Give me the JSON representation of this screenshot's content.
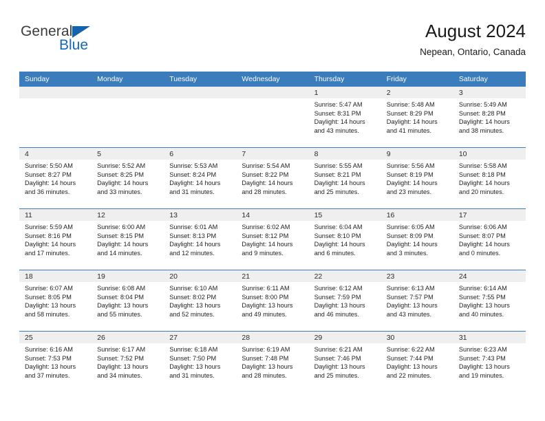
{
  "brand": {
    "name_top": "General",
    "name_bottom": "Blue",
    "triangle_color": "#1263b0",
    "text_color": "#3b3b3b",
    "accent_color": "#1268bb"
  },
  "header": {
    "title": "August 2024",
    "subtitle": "Nepean, Ontario, Canada"
  },
  "theme": {
    "header_row_bg": "#3b7cbd",
    "header_row_text": "#ffffff",
    "daynum_band_bg": "#efefef",
    "row_divider": "#3b7cbd"
  },
  "weekdays": [
    "Sunday",
    "Monday",
    "Tuesday",
    "Wednesday",
    "Thursday",
    "Friday",
    "Saturday"
  ],
  "weeks": [
    [
      {
        "day": "",
        "empty": true,
        "sunrise": "",
        "sunset": "",
        "daylight_1": "",
        "daylight_2": ""
      },
      {
        "day": "",
        "empty": true,
        "sunrise": "",
        "sunset": "",
        "daylight_1": "",
        "daylight_2": ""
      },
      {
        "day": "",
        "empty": true,
        "sunrise": "",
        "sunset": "",
        "daylight_1": "",
        "daylight_2": ""
      },
      {
        "day": "",
        "empty": true,
        "sunrise": "",
        "sunset": "",
        "daylight_1": "",
        "daylight_2": ""
      },
      {
        "day": "1",
        "sunrise": "Sunrise: 5:47 AM",
        "sunset": "Sunset: 8:31 PM",
        "daylight_1": "Daylight: 14 hours",
        "daylight_2": "and 43 minutes."
      },
      {
        "day": "2",
        "sunrise": "Sunrise: 5:48 AM",
        "sunset": "Sunset: 8:29 PM",
        "daylight_1": "Daylight: 14 hours",
        "daylight_2": "and 41 minutes."
      },
      {
        "day": "3",
        "sunrise": "Sunrise: 5:49 AM",
        "sunset": "Sunset: 8:28 PM",
        "daylight_1": "Daylight: 14 hours",
        "daylight_2": "and 38 minutes."
      }
    ],
    [
      {
        "day": "4",
        "sunrise": "Sunrise: 5:50 AM",
        "sunset": "Sunset: 8:27 PM",
        "daylight_1": "Daylight: 14 hours",
        "daylight_2": "and 36 minutes."
      },
      {
        "day": "5",
        "sunrise": "Sunrise: 5:52 AM",
        "sunset": "Sunset: 8:25 PM",
        "daylight_1": "Daylight: 14 hours",
        "daylight_2": "and 33 minutes."
      },
      {
        "day": "6",
        "sunrise": "Sunrise: 5:53 AM",
        "sunset": "Sunset: 8:24 PM",
        "daylight_1": "Daylight: 14 hours",
        "daylight_2": "and 31 minutes."
      },
      {
        "day": "7",
        "sunrise": "Sunrise: 5:54 AM",
        "sunset": "Sunset: 8:22 PM",
        "daylight_1": "Daylight: 14 hours",
        "daylight_2": "and 28 minutes."
      },
      {
        "day": "8",
        "sunrise": "Sunrise: 5:55 AM",
        "sunset": "Sunset: 8:21 PM",
        "daylight_1": "Daylight: 14 hours",
        "daylight_2": "and 25 minutes."
      },
      {
        "day": "9",
        "sunrise": "Sunrise: 5:56 AM",
        "sunset": "Sunset: 8:19 PM",
        "daylight_1": "Daylight: 14 hours",
        "daylight_2": "and 23 minutes."
      },
      {
        "day": "10",
        "sunrise": "Sunrise: 5:58 AM",
        "sunset": "Sunset: 8:18 PM",
        "daylight_1": "Daylight: 14 hours",
        "daylight_2": "and 20 minutes."
      }
    ],
    [
      {
        "day": "11",
        "sunrise": "Sunrise: 5:59 AM",
        "sunset": "Sunset: 8:16 PM",
        "daylight_1": "Daylight: 14 hours",
        "daylight_2": "and 17 minutes."
      },
      {
        "day": "12",
        "sunrise": "Sunrise: 6:00 AM",
        "sunset": "Sunset: 8:15 PM",
        "daylight_1": "Daylight: 14 hours",
        "daylight_2": "and 14 minutes."
      },
      {
        "day": "13",
        "sunrise": "Sunrise: 6:01 AM",
        "sunset": "Sunset: 8:13 PM",
        "daylight_1": "Daylight: 14 hours",
        "daylight_2": "and 12 minutes."
      },
      {
        "day": "14",
        "sunrise": "Sunrise: 6:02 AM",
        "sunset": "Sunset: 8:12 PM",
        "daylight_1": "Daylight: 14 hours",
        "daylight_2": "and 9 minutes."
      },
      {
        "day": "15",
        "sunrise": "Sunrise: 6:04 AM",
        "sunset": "Sunset: 8:10 PM",
        "daylight_1": "Daylight: 14 hours",
        "daylight_2": "and 6 minutes."
      },
      {
        "day": "16",
        "sunrise": "Sunrise: 6:05 AM",
        "sunset": "Sunset: 8:09 PM",
        "daylight_1": "Daylight: 14 hours",
        "daylight_2": "and 3 minutes."
      },
      {
        "day": "17",
        "sunrise": "Sunrise: 6:06 AM",
        "sunset": "Sunset: 8:07 PM",
        "daylight_1": "Daylight: 14 hours",
        "daylight_2": "and 0 minutes."
      }
    ],
    [
      {
        "day": "18",
        "sunrise": "Sunrise: 6:07 AM",
        "sunset": "Sunset: 8:05 PM",
        "daylight_1": "Daylight: 13 hours",
        "daylight_2": "and 58 minutes."
      },
      {
        "day": "19",
        "sunrise": "Sunrise: 6:08 AM",
        "sunset": "Sunset: 8:04 PM",
        "daylight_1": "Daylight: 13 hours",
        "daylight_2": "and 55 minutes."
      },
      {
        "day": "20",
        "sunrise": "Sunrise: 6:10 AM",
        "sunset": "Sunset: 8:02 PM",
        "daylight_1": "Daylight: 13 hours",
        "daylight_2": "and 52 minutes."
      },
      {
        "day": "21",
        "sunrise": "Sunrise: 6:11 AM",
        "sunset": "Sunset: 8:00 PM",
        "daylight_1": "Daylight: 13 hours",
        "daylight_2": "and 49 minutes."
      },
      {
        "day": "22",
        "sunrise": "Sunrise: 6:12 AM",
        "sunset": "Sunset: 7:59 PM",
        "daylight_1": "Daylight: 13 hours",
        "daylight_2": "and 46 minutes."
      },
      {
        "day": "23",
        "sunrise": "Sunrise: 6:13 AM",
        "sunset": "Sunset: 7:57 PM",
        "daylight_1": "Daylight: 13 hours",
        "daylight_2": "and 43 minutes."
      },
      {
        "day": "24",
        "sunrise": "Sunrise: 6:14 AM",
        "sunset": "Sunset: 7:55 PM",
        "daylight_1": "Daylight: 13 hours",
        "daylight_2": "and 40 minutes."
      }
    ],
    [
      {
        "day": "25",
        "sunrise": "Sunrise: 6:16 AM",
        "sunset": "Sunset: 7:53 PM",
        "daylight_1": "Daylight: 13 hours",
        "daylight_2": "and 37 minutes."
      },
      {
        "day": "26",
        "sunrise": "Sunrise: 6:17 AM",
        "sunset": "Sunset: 7:52 PM",
        "daylight_1": "Daylight: 13 hours",
        "daylight_2": "and 34 minutes."
      },
      {
        "day": "27",
        "sunrise": "Sunrise: 6:18 AM",
        "sunset": "Sunset: 7:50 PM",
        "daylight_1": "Daylight: 13 hours",
        "daylight_2": "and 31 minutes."
      },
      {
        "day": "28",
        "sunrise": "Sunrise: 6:19 AM",
        "sunset": "Sunset: 7:48 PM",
        "daylight_1": "Daylight: 13 hours",
        "daylight_2": "and 28 minutes."
      },
      {
        "day": "29",
        "sunrise": "Sunrise: 6:21 AM",
        "sunset": "Sunset: 7:46 PM",
        "daylight_1": "Daylight: 13 hours",
        "daylight_2": "and 25 minutes."
      },
      {
        "day": "30",
        "sunrise": "Sunrise: 6:22 AM",
        "sunset": "Sunset: 7:44 PM",
        "daylight_1": "Daylight: 13 hours",
        "daylight_2": "and 22 minutes."
      },
      {
        "day": "31",
        "sunrise": "Sunrise: 6:23 AM",
        "sunset": "Sunset: 7:43 PM",
        "daylight_1": "Daylight: 13 hours",
        "daylight_2": "and 19 minutes."
      }
    ]
  ]
}
